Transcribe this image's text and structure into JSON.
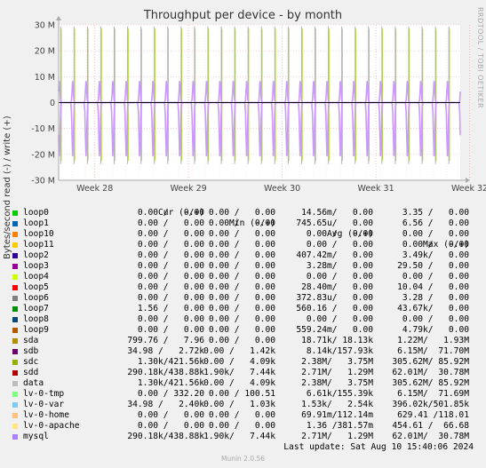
{
  "chart_data": {
    "type": "line",
    "title": "Throughput per device - by month",
    "ylabel": "Bytes/second read (-) / write (+)",
    "ylim": [
      -30000000,
      30000000
    ],
    "y_ticks": [
      "30 M",
      "20 M",
      "10 M",
      "0",
      "-10 M",
      "-20 M",
      "-30 M"
    ],
    "y_tick_values": [
      30000000,
      20000000,
      10000000,
      0,
      -10000000,
      -20000000,
      -30000000
    ],
    "x_range_days": [
      0,
      30
    ],
    "x_ticks": [
      "Week 28",
      "Week 29",
      "Week 30",
      "Week 31",
      "Week 32"
    ],
    "x_tick_days": [
      2.7,
      9.7,
      16.7,
      23.7,
      30.7
    ],
    "grid": true,
    "series_summary": [
      {
        "name": "mysql",
        "color": "#cc99ff",
        "write_peak": 8500000,
        "read_peak": -21000000,
        "period_days": 1
      },
      {
        "name": "sdc",
        "color": "#99cc00",
        "write_peak": 30000000,
        "read_peak": -25000000,
        "period_days": 1
      },
      {
        "name": "data",
        "color": "#b0b0b0",
        "write_peak": 30000000,
        "read_peak": -25000000,
        "period_days": 1
      }
    ]
  },
  "watermark": "RRDTOOL / TOBI OETIKER",
  "legend": {
    "headers": {
      "cur": "Cur (-/+)",
      "min": "Min (-/+)",
      "avg": "Avg (-/+)",
      "max": "Max (-/+)"
    },
    "rows": [
      {
        "name": "loop0",
        "color": "#00cc00",
        "cur": "0.00 /   0.00",
        "min": "0.00 /   0.00",
        "avg": "14.56m/   0.00",
        "max": "3.35 /   0.00"
      },
      {
        "name": "loop1",
        "color": "#0066b3",
        "cur": "0.00 /   0.00",
        "min": "0.00 /   0.00",
        "avg": "745.65u/   0.00",
        "max": "6.56 /   0.00"
      },
      {
        "name": "loop10",
        "color": "#ff8000",
        "cur": "0.00 /   0.00",
        "min": "0.00 /   0.00",
        "avg": "0.00 /   0.00",
        "max": "0.00 /   0.00"
      },
      {
        "name": "loop11",
        "color": "#ffcc00",
        "cur": "0.00 /   0.00",
        "min": "0.00 /   0.00",
        "avg": "0.00 /   0.00",
        "max": "0.00 /   0.00"
      },
      {
        "name": "loop2",
        "color": "#330099",
        "cur": "0.00 /   0.00",
        "min": "0.00 /   0.00",
        "avg": "407.42m/   0.00",
        "max": "3.49k/   0.00"
      },
      {
        "name": "loop3",
        "color": "#990099",
        "cur": "0.00 /   0.00",
        "min": "0.00 /   0.00",
        "avg": "3.28m/   0.00",
        "max": "29.50 /   0.00"
      },
      {
        "name": "loop4",
        "color": "#ccff00",
        "cur": "0.00 /   0.00",
        "min": "0.00 /   0.00",
        "avg": "0.00 /   0.00",
        "max": "0.00 /   0.00"
      },
      {
        "name": "loop5",
        "color": "#ff0000",
        "cur": "0.00 /   0.00",
        "min": "0.00 /   0.00",
        "avg": "28.40m/   0.00",
        "max": "10.04 /   0.00"
      },
      {
        "name": "loop6",
        "color": "#808080",
        "cur": "0.00 /   0.00",
        "min": "0.00 /   0.00",
        "avg": "372.83u/   0.00",
        "max": "3.28 /   0.00"
      },
      {
        "name": "loop7",
        "color": "#008f00",
        "cur": "1.56 /   0.00",
        "min": "0.00 /   0.00",
        "avg": "560.16 /   0.00",
        "max": "43.67k/   0.00"
      },
      {
        "name": "loop8",
        "color": "#00487d",
        "cur": "0.00 /   0.00",
        "min": "0.00 /   0.00",
        "avg": "0.00 /   0.00",
        "max": "0.00 /   0.00"
      },
      {
        "name": "loop9",
        "color": "#b35a00",
        "cur": "0.00 /   0.00",
        "min": "0.00 /   0.00",
        "avg": "559.24m/   0.00",
        "max": "4.79k/   0.00"
      },
      {
        "name": "sda",
        "color": "#b38f00",
        "cur": "799.76 /   7.96",
        "min": "0.00 /   0.00",
        "avg": "18.71k/ 18.13k",
        "max": "1.22M/   1.93M"
      },
      {
        "name": "sdb",
        "color": "#6b006b",
        "cur": "34.98 /   2.72k",
        "min": "0.00 /   1.42k",
        "avg": "8.14k/157.93k",
        "max": "6.15M/  71.70M"
      },
      {
        "name": "sdc",
        "color": "#8fb300",
        "cur": "1.30k/421.56k",
        "min": "0.00 /   4.09k",
        "avg": "2.38M/   3.75M",
        "max": "305.62M/ 85.92M"
      },
      {
        "name": "sdd",
        "color": "#b30000",
        "cur": "290.18k/438.88k",
        "min": "1.90k/   7.44k",
        "avg": "2.71M/   1.29M",
        "max": "62.01M/  30.78M"
      },
      {
        "name": "data",
        "color": "#bebebe",
        "cur": "1.30k/421.56k",
        "min": "0.00 /   4.09k",
        "avg": "2.38M/   3.75M",
        "max": "305.62M/ 85.92M"
      },
      {
        "name": "lv-0-tmp",
        "color": "#80ff80",
        "cur": "0.00 / 332.20",
        "min": "0.00 / 100.51",
        "avg": "6.61k/155.39k",
        "max": "6.15M/  71.69M"
      },
      {
        "name": "lv-0-var",
        "color": "#80c9ff",
        "cur": "34.98 /   2.40k",
        "min": "0.00 /   1.03k",
        "avg": "1.53k/   2.54k",
        "max": "396.02k/501.85k"
      },
      {
        "name": "lv-0-home",
        "color": "#ffc080",
        "cur": "0.00 /   0.00",
        "min": "0.00 /   0.00",
        "avg": "69.91m/112.14m",
        "max": "629.41 /118.01"
      },
      {
        "name": "lv-0-apache",
        "color": "#ffe680",
        "cur": "0.00 /   0.00",
        "min": "0.00 /   0.00",
        "avg": "1.36 /381.57m",
        "max": "454.61 /  66.68"
      },
      {
        "name": "mysql",
        "color": "#aa80ff",
        "cur": "290.18k/438.88k",
        "min": "1.90k/   7.44k",
        "avg": "2.71M/   1.29M",
        "max": "62.01M/  30.78M"
      }
    ]
  },
  "footer": {
    "last_update": "Last update: Sat Aug 10 15:40:06 2024",
    "generator": "Munin 2.0.56"
  }
}
